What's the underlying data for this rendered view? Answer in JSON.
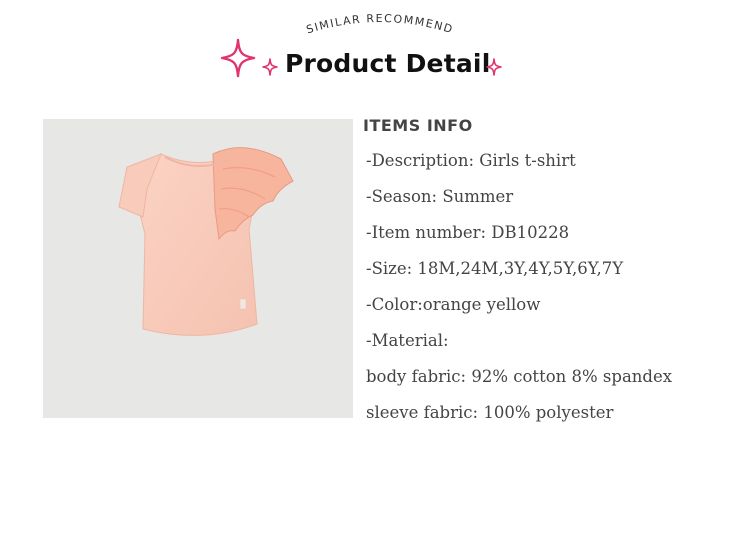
{
  "header": {
    "subtitle_arc": "SIMILAR RECOMMEND",
    "title": "Product Detail",
    "accent_color": "#e0336f"
  },
  "product": {
    "image_alt_icon": "girls-t-shirt-photo"
  },
  "items_info": {
    "heading": "ITEMS INFO",
    "lines": [
      "-Description: Girls t-shirt",
      "-Season: Summer",
      "-Item number: DB10228",
      "-Size: 18M,24M,3Y,4Y,5Y,6Y,7Y",
      "-Color:orange yellow",
      "-Material:",
      "body fabric: 92% cotton 8% spandex",
      "sleeve fabric: 100% polyester"
    ]
  }
}
